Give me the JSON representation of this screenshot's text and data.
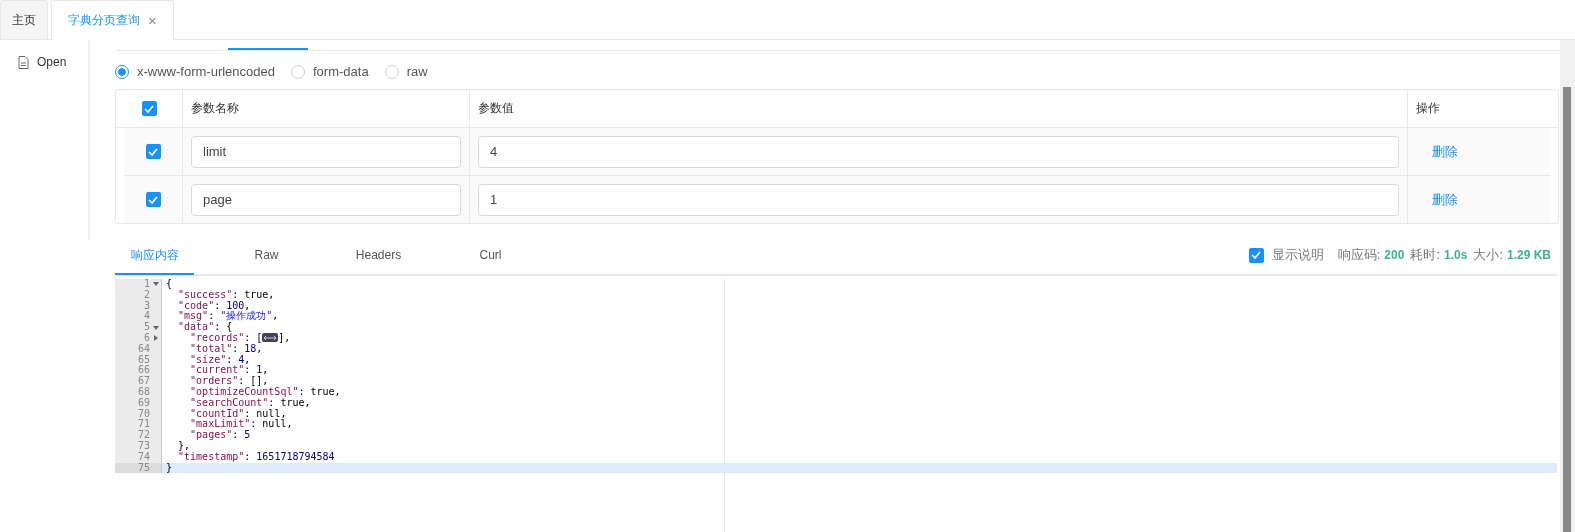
{
  "page_tabs": [
    {
      "label": "主页",
      "selected": false
    },
    {
      "label": "字典分页查询",
      "selected": true,
      "close": "×"
    }
  ],
  "sidebar": {
    "items": [
      {
        "label": "Open"
      }
    ]
  },
  "body_type": [
    {
      "label": "x-www-form-urlencoded",
      "selected": true
    },
    {
      "label": "form-data",
      "selected": false
    },
    {
      "label": "raw",
      "selected": false
    }
  ],
  "params": {
    "all_checked": true,
    "columns": [
      "参数名称",
      "参数值",
      "操作"
    ],
    "rows": [
      {
        "checked": true,
        "name": "limit",
        "value": "4",
        "action": "删除"
      },
      {
        "checked": true,
        "name": "page",
        "value": "1",
        "action": "删除"
      }
    ]
  },
  "response_tabs": [
    {
      "label": "响应内容",
      "selected": true
    },
    {
      "label": "Raw",
      "selected": false
    },
    {
      "label": "Headers",
      "selected": false
    },
    {
      "label": "Curl",
      "selected": false
    }
  ],
  "show_notes": {
    "label": "显示说明",
    "checked": true
  },
  "meta": [
    {
      "label": "响应码:",
      "value": "200"
    },
    {
      "label": "耗时:",
      "value": "1.0s"
    },
    {
      "label": "大小:",
      "value": "1.29 KB"
    }
  ],
  "code": [
    {
      "number": "1",
      "collapsed": false,
      "active": false,
      "tokens": [
        {
          "kind": "plain",
          "text": "{"
        }
      ]
    },
    {
      "number": "2",
      "active": false,
      "tokens": [
        {
          "kind": "key",
          "text": "  \"success\""
        },
        {
          "kind": "plain",
          "text": ": true,"
        }
      ]
    },
    {
      "number": "3",
      "active": false,
      "tokens": [
        {
          "kind": "key",
          "text": "  \"code\""
        },
        {
          "kind": "plain",
          "text": ": "
        },
        {
          "kind": "number",
          "text": "100"
        },
        {
          "kind": "plain",
          "text": ","
        }
      ]
    },
    {
      "number": "4",
      "active": false,
      "tokens": [
        {
          "kind": "key",
          "text": "  \"msg\""
        },
        {
          "kind": "plain",
          "text": ": "
        },
        {
          "kind": "string",
          "text": "\"操作成功\""
        },
        {
          "kind": "plain",
          "text": ","
        }
      ]
    },
    {
      "number": "5",
      "collapsed": false,
      "active": false,
      "tokens": [
        {
          "kind": "key",
          "text": "  \"data\""
        },
        {
          "kind": "plain",
          "text": ": {"
        }
      ]
    },
    {
      "number": "6",
      "collapsed": true,
      "active": false,
      "tokens": [
        {
          "kind": "key",
          "text": "    \"records\""
        },
        {
          "kind": "plain",
          "text": ": ["
        },
        {
          "kind": "folded"
        },
        {
          "kind": "plain",
          "text": "],"
        }
      ]
    },
    {
      "number": "64",
      "active": false,
      "tokens": [
        {
          "kind": "key",
          "text": "    \"total\""
        },
        {
          "kind": "plain",
          "text": ": "
        },
        {
          "kind": "number",
          "text": "18"
        },
        {
          "kind": "plain",
          "text": ","
        }
      ]
    },
    {
      "number": "65",
      "active": false,
      "tokens": [
        {
          "kind": "key",
          "text": "    \"size\""
        },
        {
          "kind": "plain",
          "text": ": "
        },
        {
          "kind": "number",
          "text": "4"
        },
        {
          "kind": "plain",
          "text": ","
        }
      ]
    },
    {
      "number": "66",
      "active": false,
      "tokens": [
        {
          "kind": "key",
          "text": "    \"current\""
        },
        {
          "kind": "plain",
          "text": ": "
        },
        {
          "kind": "number",
          "text": "1"
        },
        {
          "kind": "plain",
          "text": ","
        }
      ]
    },
    {
      "number": "67",
      "active": false,
      "tokens": [
        {
          "kind": "key",
          "text": "    \"orders\""
        },
        {
          "kind": "plain",
          "text": ": [],"
        }
      ]
    },
    {
      "number": "68",
      "active": false,
      "tokens": [
        {
          "kind": "key",
          "text": "    \"optimizeCountSql\""
        },
        {
          "kind": "plain",
          "text": ": true,"
        }
      ]
    },
    {
      "number": "69",
      "active": false,
      "tokens": [
        {
          "kind": "key",
          "text": "    \"searchCount\""
        },
        {
          "kind": "plain",
          "text": ": true,"
        }
      ]
    },
    {
      "number": "70",
      "active": false,
      "tokens": [
        {
          "kind": "key",
          "text": "    \"countId\""
        },
        {
          "kind": "plain",
          "text": ": null,"
        }
      ]
    },
    {
      "number": "71",
      "active": false,
      "tokens": [
        {
          "kind": "key",
          "text": "    \"maxLimit\""
        },
        {
          "kind": "plain",
          "text": ": null,"
        }
      ]
    },
    {
      "number": "72",
      "active": false,
      "tokens": [
        {
          "kind": "key",
          "text": "    \"pages\""
        },
        {
          "kind": "plain",
          "text": ": "
        },
        {
          "kind": "number",
          "text": "5"
        }
      ]
    },
    {
      "number": "73",
      "active": false,
      "tokens": [
        {
          "kind": "plain",
          "text": "  },"
        }
      ]
    },
    {
      "number": "74",
      "active": false,
      "tokens": [
        {
          "kind": "key",
          "text": "  \"timestamp\""
        },
        {
          "kind": "plain",
          "text": ": "
        },
        {
          "kind": "number",
          "text": "1651718794584"
        }
      ]
    },
    {
      "number": "75",
      "active": true,
      "tokens": [
        {
          "kind": "plain",
          "text": "}"
        }
      ]
    }
  ]
}
